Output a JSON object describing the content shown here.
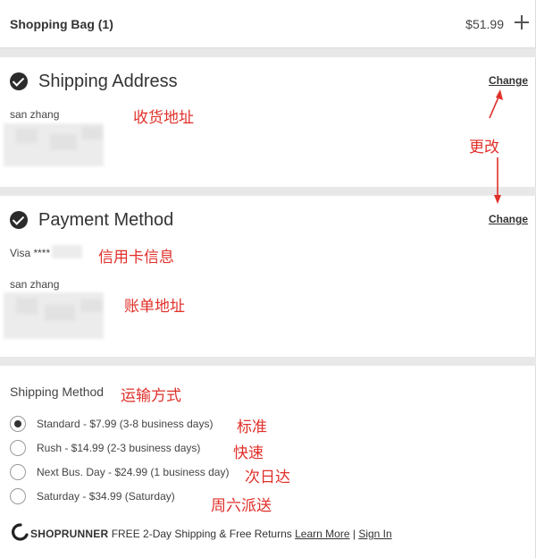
{
  "bag": {
    "title": "Shopping Bag (1)",
    "total": "$51.99",
    "expand_icon": "plus-icon"
  },
  "shipping_address": {
    "title": "Shipping Address",
    "change_label": "Change",
    "name": "san zhang",
    "annotation": "收货地址"
  },
  "payment_method": {
    "title": "Payment Method",
    "change_label": "Change",
    "card": "Visa ****",
    "card_annotation": "信用卡信息",
    "billing_name": "san zhang",
    "billing_annotation": "账单地址"
  },
  "change_annotation": "更改",
  "shipping_method": {
    "title": "Shipping Method",
    "annotation": "运输方式",
    "options": [
      {
        "label": "Standard - $7.99 (3-8 business days)",
        "annotation": "标准",
        "selected": true
      },
      {
        "label": "Rush - $14.99 (2-3 business days)",
        "annotation": "快速",
        "selected": false
      },
      {
        "label": "Next Bus. Day - $24.99 (1 business day)",
        "annotation": "次日达",
        "selected": false
      },
      {
        "label": "Saturday - $34.99 (Saturday)",
        "annotation": "周六派送",
        "selected": false
      }
    ]
  },
  "shoprunner": {
    "brand": "SHOPRUNNER",
    "text": "FREE 2-Day Shipping & Free Returns",
    "learn_more": "Learn More",
    "separator": "|",
    "sign_in": "Sign In"
  },
  "colors": {
    "annotation": "#e0302a",
    "check": "#2b2b2b",
    "background": "#e8e8e8"
  }
}
